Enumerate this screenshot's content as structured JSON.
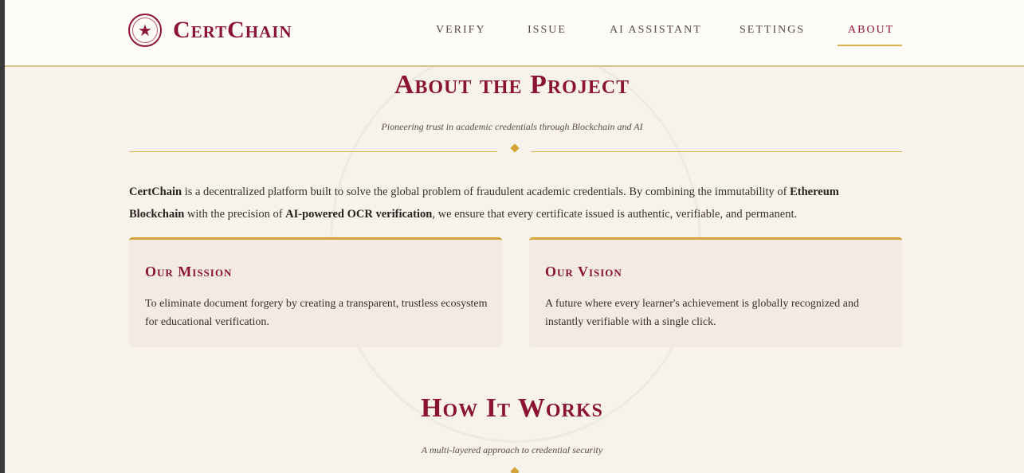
{
  "brand": {
    "name": "CertChain",
    "seal_icon": "star-seal-icon"
  },
  "nav": {
    "items": [
      {
        "label": "VERIFY",
        "active": false
      },
      {
        "label": "ISSUE",
        "active": false
      },
      {
        "label": "AI ASSISTANT",
        "active": false
      },
      {
        "label": "SETTINGS",
        "active": false
      },
      {
        "label": "ABOUT",
        "active": true
      }
    ]
  },
  "about": {
    "title": "About the Project",
    "subtitle": "Pioneering trust in academic credentials through Blockchain and AI",
    "intro": {
      "p1": "CertChain",
      "p2": " is a decentralized platform built to solve the global problem of fraudulent academic credentials. By combining the immutability of ",
      "p3": "Ethereum Blockchain",
      "p4": " with the precision of ",
      "p5": "AI-powered OCR verification",
      "p6": ", we ensure that every certificate issued is authentic, verifiable, and permanent."
    },
    "cards": [
      {
        "title": "Our Mission",
        "text": "To eliminate document forgery by creating a transparent, trustless ecosystem for educational verification."
      },
      {
        "title": "Our Vision",
        "text": "A future where every learner's achievement is globally recognized and instantly verifiable with a single click."
      }
    ]
  },
  "how": {
    "title": "How It Works",
    "subtitle": "A multi-layered approach to credential security"
  },
  "colors": {
    "accent": "#8a1432",
    "gold": "#d4b24a",
    "background": "#f7f3ec",
    "card": "#f3ebe1"
  }
}
